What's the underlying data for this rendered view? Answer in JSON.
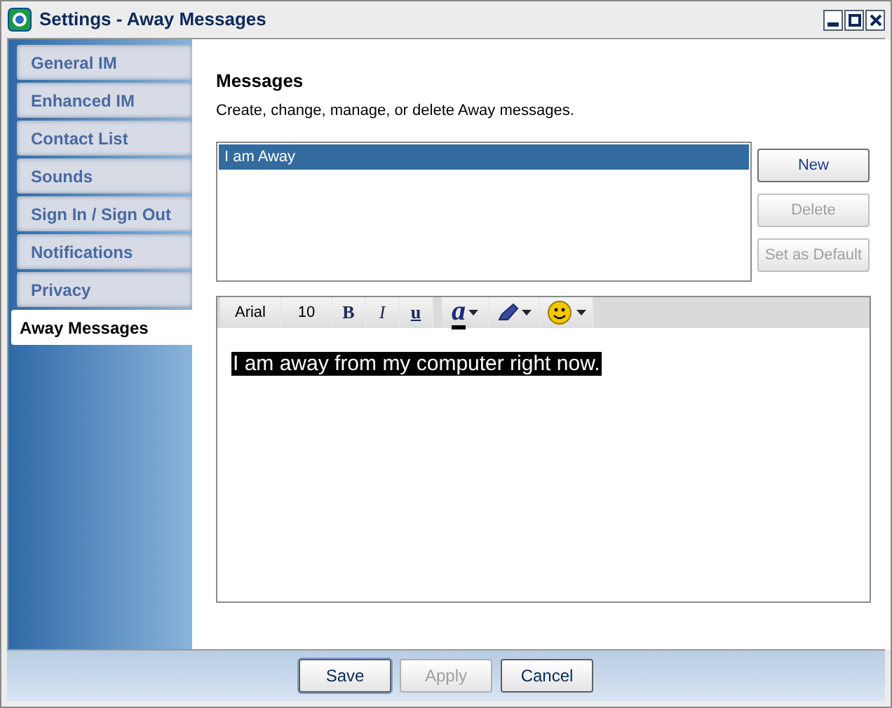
{
  "window": {
    "title": "Settings - Away Messages"
  },
  "sidebar": {
    "items": [
      {
        "label": "General IM",
        "selected": false
      },
      {
        "label": "Enhanced IM",
        "selected": false
      },
      {
        "label": "Contact List",
        "selected": false
      },
      {
        "label": "Sounds",
        "selected": false
      },
      {
        "label": "Sign In / Sign Out",
        "selected": false
      },
      {
        "label": "Notifications",
        "selected": false
      },
      {
        "label": "Privacy",
        "selected": false
      },
      {
        "label": "Away Messages",
        "selected": true
      }
    ]
  },
  "section": {
    "title": "Messages",
    "description": "Create, change, manage, or delete Away messages."
  },
  "messages": [
    {
      "label": "I am Away",
      "selected": true
    }
  ],
  "message_buttons": [
    {
      "label": "New",
      "disabled": false
    },
    {
      "label": "Delete",
      "disabled": true
    },
    {
      "label": "Set as Default",
      "disabled": true
    }
  ],
  "toolbar": [
    {
      "kind": "font",
      "label": "Arial"
    },
    {
      "kind": "size",
      "label": "10"
    },
    {
      "kind": "bold",
      "label": "B"
    },
    {
      "kind": "italic",
      "label": "I"
    },
    {
      "kind": "underline",
      "label": "u"
    },
    {
      "kind": "font-color",
      "label": "a"
    },
    {
      "kind": "highlight"
    },
    {
      "kind": "emoticon"
    }
  ],
  "editor": {
    "text": "I am away from my computer right now."
  },
  "footer_buttons": [
    {
      "label": "Save",
      "disabled": false
    },
    {
      "label": "Apply",
      "disabled": true
    },
    {
      "label": "Cancel",
      "disabled": false
    }
  ]
}
